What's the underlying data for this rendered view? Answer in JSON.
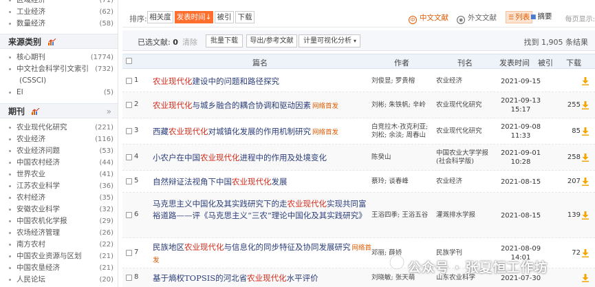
{
  "sidebar": {
    "top_items": [
      {
        "label": "区域经济",
        "count": "(71)"
      },
      {
        "label": "工业经济",
        "count": "(62)"
      },
      {
        "label": "数量经济",
        "count": "(58)"
      }
    ],
    "source_group": {
      "title": "来源类别",
      "items": [
        {
          "label": "核心期刊",
          "count": "(1774)"
        },
        {
          "label": "中文社会科学引文索引",
          "label2": "(CSSCI)",
          "count": "(732)"
        },
        {
          "label": "EI",
          "count": "(5)"
        }
      ]
    },
    "journal_group": {
      "title": "期刊",
      "more": "»",
      "items": [
        {
          "label": "农业现代化研究",
          "count": "(221)"
        },
        {
          "label": "农业经济",
          "count": "(116)"
        },
        {
          "label": "农业经济问题",
          "count": "(53)"
        },
        {
          "label": "中国农村经济",
          "count": "(44)"
        },
        {
          "label": "世界农业",
          "count": "(41)"
        },
        {
          "label": "江苏农业科学",
          "count": "(36)"
        },
        {
          "label": "农村经济",
          "count": "(35)"
        },
        {
          "label": "安徽农业科学",
          "count": "(32)"
        },
        {
          "label": "中国农机化学报",
          "count": "(29)"
        },
        {
          "label": "农场经济管理",
          "count": "(26)"
        },
        {
          "label": "南方农村",
          "count": "(22)"
        },
        {
          "label": "中国农业资源与区划",
          "count": "(21)"
        },
        {
          "label": "中国农垦经济",
          "count": "(21)"
        },
        {
          "label": "人民论坛",
          "count": "(20)"
        }
      ]
    }
  },
  "sortbar": {
    "label": "排序:",
    "buttons": [
      "相关度",
      "发表时间",
      "被引",
      "下载"
    ],
    "active_index": 1,
    "active_arrow": "↓",
    "lang_cn": "中文文献",
    "lang_en": "外文文献",
    "view_list": "列表",
    "view_abstract": "摘要",
    "per_page": "每页显示:"
  },
  "toolbar": {
    "selected_label": "已选文献:",
    "selected_count": "0",
    "clear": "清除",
    "batch_download": "批量下载",
    "export": "导出/参考文献",
    "visualize": "计量可视化分析",
    "found": "找到 1,905 条结果"
  },
  "table": {
    "headers": {
      "title": "篇名",
      "author": "作者",
      "journal": "刊名",
      "date": "发表时间",
      "cite": "被引",
      "download": "下载"
    },
    "rows": [
      {
        "num": "1",
        "title": [
          {
            "t": "农业现代化",
            "h": true
          },
          {
            "t": "建设中的问题和路径探究"
          }
        ],
        "online": "",
        "author": "刘俊显; 罗贵榕",
        "journal": "农业经济",
        "date1": "2021-09-15",
        "date2": "",
        "cite": "",
        "downloads": ""
      },
      {
        "num": "2",
        "title": [
          {
            "t": "农业现代化",
            "h": true
          },
          {
            "t": "与城乡融合的耦合协调和驱动因素"
          }
        ],
        "online": "网络首发",
        "author": "刘彬; 朱铁帆; 辛岭",
        "journal": "农业现代化研究",
        "date1": "2021-09-13",
        "date2": "15:17",
        "cite": "",
        "downloads": "255"
      },
      {
        "num": "3",
        "title": [
          {
            "t": "西藏"
          },
          {
            "t": "农业现代化",
            "h": true
          },
          {
            "t": "对城镇化发展的作用机制研究"
          }
        ],
        "online": "网络首发",
        "author": "白竞拉木·孜克利亚; 刘松; 余淡; 周春山",
        "journal": "农业现代化研究",
        "date1": "2021-09-08",
        "date2": "11:33",
        "cite": "",
        "downloads": "85"
      },
      {
        "num": "4",
        "title": [
          {
            "t": "小农户在中国"
          },
          {
            "t": "农业现代化",
            "h": true
          },
          {
            "t": "进程中的作用及处境变化"
          }
        ],
        "online": "",
        "author": "陈癸山",
        "journal": "中国农业大学学报(社会科学版)",
        "date1": "2021-09-01",
        "date2": "10:28",
        "cite": "",
        "downloads": "258"
      },
      {
        "num": "5",
        "title": [
          {
            "t": "自然辩证法视角下中国"
          },
          {
            "t": "农业现代化",
            "h": true
          },
          {
            "t": "发展"
          }
        ],
        "online": "",
        "author": "蔡玲; 谈春峰",
        "journal": "农业经济",
        "date1": "2021-08-15",
        "date2": "",
        "cite": "",
        "downloads": "207"
      },
      {
        "num": "6",
        "title": [
          {
            "t": "马克思主义中国化及其实践研究下的走"
          },
          {
            "t": "农业现代化",
            "h": true
          },
          {
            "t": "实现共同富裕道路——评《马克思主义“三农”理论中国化及其实践研究》"
          }
        ],
        "online": "",
        "author": "王浴四季; 王浴五谷",
        "journal": "灌溉排水学报",
        "date1": "2021-08-15",
        "date2": "",
        "cite": "",
        "downloads": "139"
      },
      {
        "num": "7",
        "title": [
          {
            "t": "民族地区"
          },
          {
            "t": "农业现代化",
            "h": true
          },
          {
            "t": "与信息化的同步特征及协同发展研究"
          }
        ],
        "online": "网络首发",
        "author": "邓丽; 薛娇",
        "journal": "民族学刊",
        "date1": "2021-08-09",
        "date2": "14:01",
        "cite": "",
        "downloads": "72"
      },
      {
        "num": "8",
        "title": [
          {
            "t": "基于熵权TOPSIS的河北省"
          },
          {
            "t": "农业现代化",
            "h": true
          },
          {
            "t": "水平评价"
          }
        ],
        "online": "",
        "author": "刘晓敏; 张天萌",
        "journal": "山东农业科学",
        "date1": "2021-07-30",
        "date2": "",
        "cite": "",
        "downloads": ""
      }
    ]
  },
  "watermark": {
    "text": "公众号 · 张夏恒工作坊"
  },
  "colors": {
    "accent": "#ff6e2c",
    "highlight": "#d62b1b",
    "link": "#2c3e7a",
    "online": "#e05a00",
    "download_icon": "#f5a500"
  }
}
